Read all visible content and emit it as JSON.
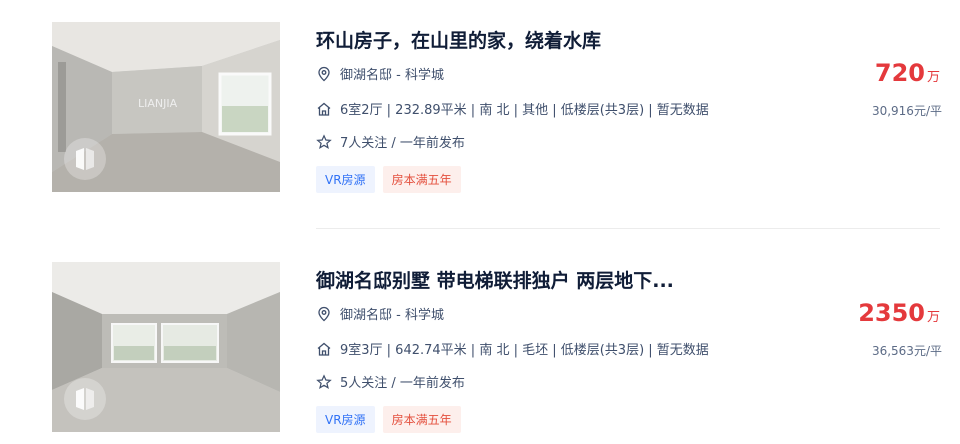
{
  "listings": [
    {
      "title": "环山房子，在山里的家，绕着水库",
      "location": "御湖名邸 - 科学城",
      "info": "6室2厅 | 232.89平米 | 南 北 | 其他 | 低楼层(共3层) | 暂无数据",
      "follow": "7人关注 / 一年前发布",
      "tags": [
        "VR房源",
        "房本满五年"
      ],
      "price": "720",
      "price_unit": "万",
      "unit_price": "30,916元/平",
      "watermark": "LIANJIA"
    },
    {
      "title": "御湖名邸别墅 带电梯联排独户 两层地下...",
      "location": "御湖名邸 - 科学城",
      "info": "9室3厅 | 642.74平米 | 南 北 | 毛坯 | 低楼层(共3层) | 暂无数据",
      "follow": "5人关注 / 一年前发布",
      "tags": [
        "VR房源",
        "房本满五年"
      ],
      "price": "2350",
      "price_unit": "万",
      "unit_price": "36,563元/平"
    }
  ],
  "icons": [
    "location-pin-icon",
    "house-icon",
    "star-icon",
    "vr-badge-icon"
  ],
  "colors": {
    "title": "#101d37",
    "price": "#e4393c",
    "vr_tag": "#3072f6",
    "year_tag": "#e4503e"
  }
}
